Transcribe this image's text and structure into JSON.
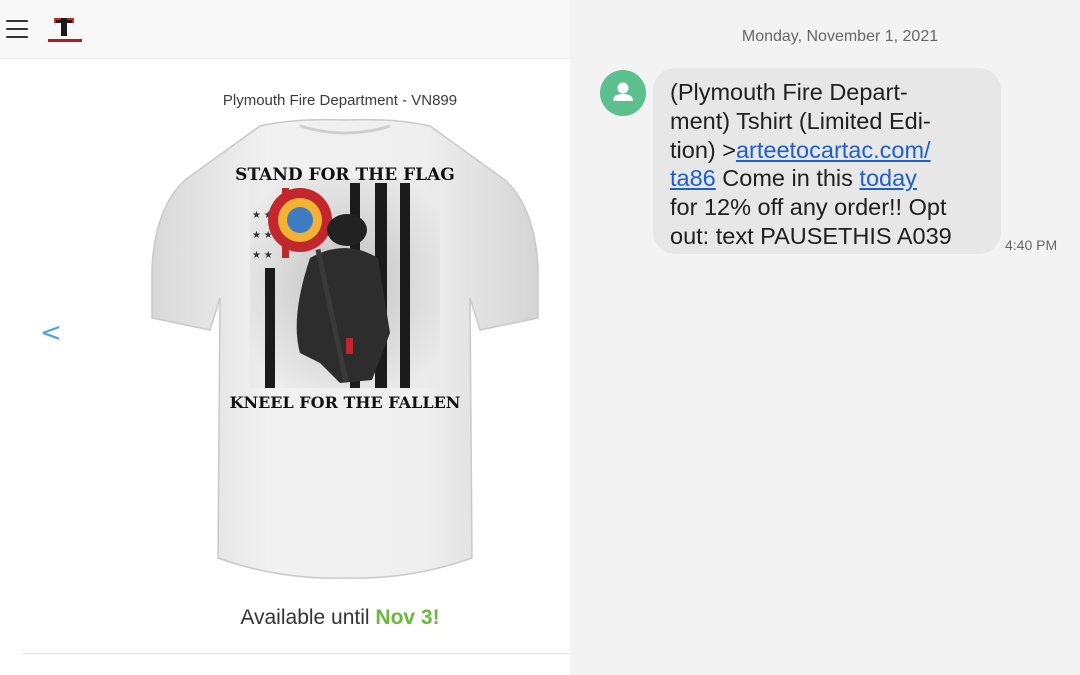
{
  "shop": {
    "product_title": "Plymouth Fire Department - VN899",
    "shirt_top_text": "STAND FOR THE FLAG",
    "shirt_bottom_text": "KNEEL FOR THE FALLEN",
    "prev_arrow": "<",
    "available_prefix": "Available until ",
    "available_date": "Nov 3!"
  },
  "sms": {
    "date": "Monday, November 1, 2021",
    "time": "4:40 PM",
    "line1": "(Plymouth Fire Depart-",
    "line2": "ment) Tshirt (Limited Edi-",
    "line3_prefix": "tion) >",
    "link_part1": "arteetocartac.com/",
    "link_part2": "ta86",
    "line4_mid": " Come in this ",
    "link_today": "today",
    "line5": "for 12% off any order!! Opt",
    "line6": "out: text PAUSETHIS A039"
  },
  "icons": {
    "menu": "hamburger-icon",
    "avatar": "person-icon"
  },
  "colors": {
    "accent_green": "#6cb83a",
    "link_blue": "#1f5fc8",
    "arrow_blue": "#4aa3df",
    "avatar_green": "#5cbf8e"
  }
}
